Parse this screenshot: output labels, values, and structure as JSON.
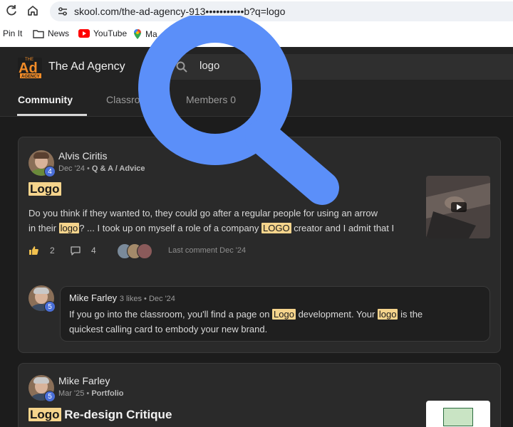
{
  "browser": {
    "url": "skool.com/the-ad-agency-913•••••••••••b?q=logo",
    "bookmarks": [
      "Pin It",
      "News",
      "YouTube",
      "Ma"
    ]
  },
  "community": {
    "logo_text": "Ad",
    "logo_sub": "AGENCY",
    "logo_top": "THE",
    "name": "The Ad Agency",
    "search_value": "logo",
    "tabs": [
      "Community",
      "Classro",
      "Members 0"
    ]
  },
  "posts": [
    {
      "author": "Alvis Ciritis",
      "level": "4",
      "date": "Dec '24",
      "category": "Q & A / Advice",
      "title_highlight": "Logo",
      "title_rest": "",
      "body_1": "Do you think if they wanted to, they could go after a regular people for using an arrow",
      "body_2_pre": "in their ",
      "body_2_hl1": "logo",
      "body_2_mid": "? ... I took up on myself a role of a company ",
      "body_2_hl2": "LOGO",
      "body_2_post": " creator and I admit that I",
      "likes": "2",
      "comments": "4",
      "last_comment": "Last comment Dec '24",
      "comment": {
        "author": "Mike Farley",
        "likes": "3 likes",
        "date": "Dec '24",
        "level": "5",
        "line1_pre": "If you go into the classroom, you'll find a page on ",
        "line1_hl1": "Logo",
        "line1_mid": " development. Your ",
        "line1_hl2": "logo",
        "line1_post": " is the",
        "line2": "quickest calling card to embody your new brand."
      }
    },
    {
      "author": "Mike Farley",
      "level": "5",
      "date": "Mar '25",
      "category": "Portfolio",
      "title_highlight": "Logo",
      "title_rest": " Re-design Critique"
    }
  ],
  "colors": {
    "highlight": "#f5d48c",
    "magnifier": "#5b8ff9",
    "level_badge": "#4a6fd8",
    "background": "#1c1c1c"
  }
}
